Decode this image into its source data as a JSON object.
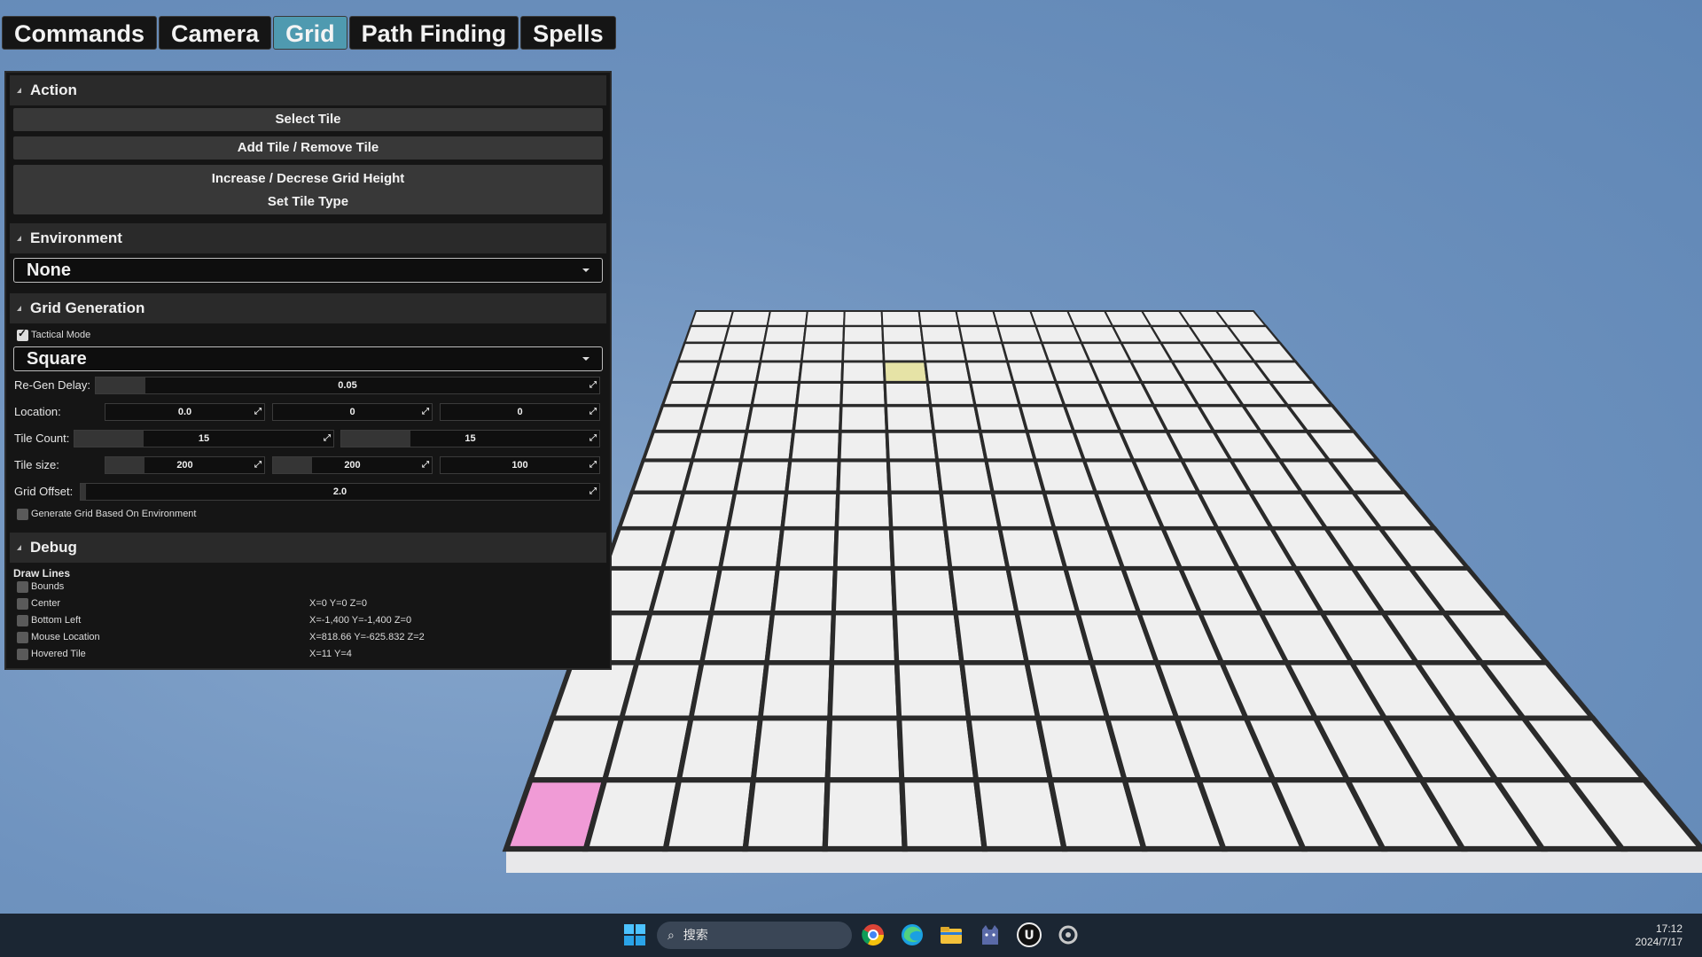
{
  "tabs": [
    "Commands",
    "Camera",
    "Grid",
    "Path Finding",
    "Spells"
  ],
  "active_tab": "Grid",
  "panel": {
    "action": {
      "title": "Action",
      "buttons": [
        "Select Tile",
        "Add Tile / Remove Tile",
        "Increase / Decrese Grid Height",
        "Set Tile Type"
      ]
    },
    "environment": {
      "title": "Environment",
      "selected": "None"
    },
    "grid_generation": {
      "title": "Grid Generation",
      "tactical_mode": {
        "label": "Tactical Mode",
        "checked": true
      },
      "shape": "Square",
      "regen_delay": {
        "label": "Re-Gen Delay:",
        "value": "0.05"
      },
      "location": {
        "label": "Location:",
        "x": "0.0",
        "y": "0",
        "z": "0"
      },
      "tile_count": {
        "label": "Tile Count:",
        "x": "15",
        "y": "15"
      },
      "tile_size": {
        "label": "Tile size:",
        "x": "200",
        "y": "200",
        "z": "100"
      },
      "grid_offset": {
        "label": "Grid Offset:",
        "value": "2.0"
      },
      "generate_env": {
        "label": "Generate Grid Based On Environment",
        "checked": false
      }
    },
    "debug": {
      "title": "Debug",
      "draw_lines": "Draw Lines",
      "rows": [
        {
          "label": "Bounds",
          "value": ""
        },
        {
          "label": "Center",
          "value": "X=0 Y=0 Z=0"
        },
        {
          "label": "Bottom Left",
          "value": "X=-1,400 Y=-1,400 Z=0"
        },
        {
          "label": "Mouse Location",
          "value": "X=818.66 Y=-625.832 Z=2"
        },
        {
          "label": "Hovered Tile",
          "value": "X=11 Y=4"
        }
      ]
    }
  },
  "grid": {
    "rows": 15,
    "cols": 15,
    "tile_color": "#efefef",
    "line_color": "#2a2a2a",
    "hovered_tile_color": "#e6e3a6",
    "selected_tile_color": "#f09bd6"
  },
  "taskbar": {
    "search_placeholder": "搜索",
    "time": "17:12",
    "date": "2024/7/17",
    "icons": [
      "windows-start-icon",
      "chrome-icon",
      "edge-icon",
      "file-explorer-icon",
      "cat-app-icon",
      "unreal-engine-icon",
      "blueprint-app-icon"
    ]
  }
}
